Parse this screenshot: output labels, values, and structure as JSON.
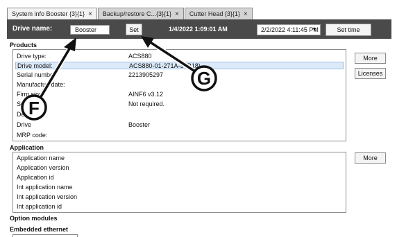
{
  "tabs": [
    {
      "label": "System info Booster {3}{1}",
      "close": "×"
    },
    {
      "label": "Backup/restore C...{3}{1}",
      "close": "×"
    },
    {
      "label": "Cutter Head {3}{1}",
      "close": "×"
    }
  ],
  "toolbar": {
    "drive_name_label": "Drive name:",
    "drive_name_value": "Booster",
    "set_label": "Set",
    "current_time": "1/4/2022 1:09:01 AM",
    "date_select_value": "2/2/2022 4:11:45 PM",
    "set_time_label": "Set time"
  },
  "products": {
    "heading": "Products",
    "rows": [
      {
        "key": "Drive type:",
        "value": "ACS880"
      },
      {
        "key": "Drive model:",
        "value": "ACS880-01-271A-3+B18)"
      },
      {
        "key": "Serial numbe",
        "value": "2213905297"
      },
      {
        "key": "Manufacturi   date:",
        "value": ""
      },
      {
        "key": "Firm      sion:",
        "value": "AINF6 v3.12"
      },
      {
        "key": "Se",
        "value": "Not required."
      },
      {
        "key": "De",
        "value": ""
      },
      {
        "key": "Drive",
        "value": "Booster"
      },
      {
        "key": "MRP code:",
        "value": ""
      }
    ],
    "more_label": "More",
    "licenses_label": "Licenses"
  },
  "application": {
    "heading": "Application",
    "rows": [
      "Application name",
      "Application version",
      "Application id",
      "Int application name",
      "Int application version",
      "Int application id"
    ],
    "more_label": "More"
  },
  "option_modules_heading": "Option modules",
  "embedded_ethernet_heading": "Embedded ethernet",
  "callouts": {
    "f": "F",
    "g": "G"
  }
}
